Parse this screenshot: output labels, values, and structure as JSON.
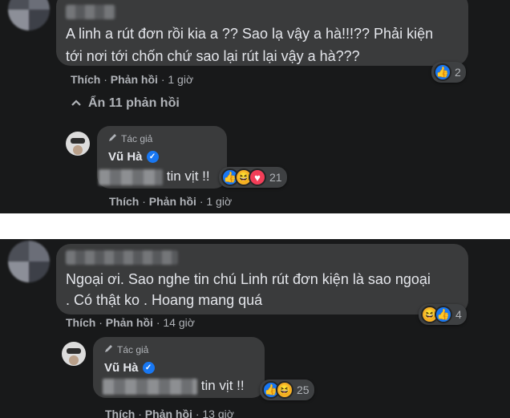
{
  "top": {
    "comment": {
      "text_line1": "A linh a rút đơn rồi kia a ?? Sao lạ vậy a hà!!!?? Phải kiện",
      "text_line2": "tới nơi tới chốn chứ sao lại rút lại vậy a hà???",
      "like_label": "Thích",
      "reply_label": "Phản hồi",
      "time": "1 giờ",
      "reaction_count": "2"
    },
    "hide_replies_label": "Ẩn 11 phản hồi",
    "reply": {
      "badge": "Tác giả",
      "author": "Vũ Hà",
      "text": "tin vịt !!",
      "reaction_count": "21",
      "like_label": "Thích",
      "reply_label": "Phản hồi",
      "time": "1 giờ"
    }
  },
  "bottom": {
    "comment": {
      "text_line1": "Ngoại ơi. Sao nghe tin chú Linh rút đơn kiện là sao ngoại",
      "text_line2": ". Có thật ko . Hoang mang quá",
      "like_label": "Thích",
      "reply_label": "Phản hồi",
      "time": "14 giờ",
      "reaction_count": "4"
    },
    "reply": {
      "badge": "Tác giả",
      "author": "Vũ Hà",
      "text": "tin vịt !!",
      "reaction_count": "25",
      "like_label": "Thích",
      "reply_label": "Phản hồi",
      "time": "13 giờ"
    }
  },
  "separator": "·",
  "colors": {
    "panel_bg": "#18191a",
    "bubble_bg": "#3a3b3c",
    "text": "#e4e6eb",
    "muted": "#b0b3b8",
    "like_blue": "#1877f2"
  },
  "icons": {
    "like": "thumbs-up-icon",
    "haha": "laughing-face-icon",
    "love": "heart-icon",
    "verified": "verified-check-icon",
    "pencil": "pencil-icon",
    "chevron": "chevron-up-icon"
  }
}
